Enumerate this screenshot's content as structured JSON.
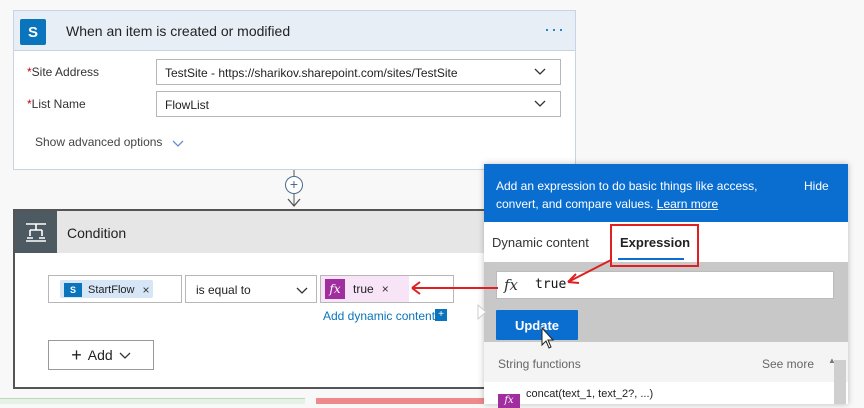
{
  "trigger": {
    "title": "When an item is created or modified",
    "icon_text": "S",
    "more": "···",
    "fields": [
      {
        "label": "Site Address",
        "required": "*",
        "value": "TestSite - https://sharikov.sharepoint.com/sites/TestSite"
      },
      {
        "label": "List Name",
        "required": "*",
        "value": "FlowList"
      }
    ],
    "advanced_label": "Show advanced options"
  },
  "connector": {
    "plus": "+"
  },
  "condition": {
    "title": "Condition",
    "left_token": {
      "icon_text": "S",
      "label": "StartFlow",
      "remove": "×"
    },
    "operator": "is equal to",
    "right_token": {
      "icon_text": "fx",
      "label": "true",
      "remove": "×"
    },
    "add_dynamic_label": "Add dynamic content",
    "add_dynamic_icon": "+",
    "add_button_label": "Add"
  },
  "panel": {
    "description": "Add an expression to do basic things like access, convert, and compare values.",
    "learn_more": "Learn more",
    "hide_label": "Hide",
    "tabs": [
      {
        "label": "Dynamic content",
        "active": false
      },
      {
        "label": "Expression",
        "active": true
      }
    ],
    "fx_glyph": "fx",
    "expression_value": "true",
    "update_label": "Update",
    "section_label": "String functions",
    "see_more_label": "See more",
    "functions": [
      {
        "icon_text": "fx",
        "label": "concat(text_1, text_2?, ...)"
      }
    ]
  },
  "colors": {
    "accent_blue": "#0a6ed1",
    "sharepoint_blue": "#0a74bd",
    "expression_purple": "#a12e9e",
    "annotation_red": "#e02020"
  }
}
